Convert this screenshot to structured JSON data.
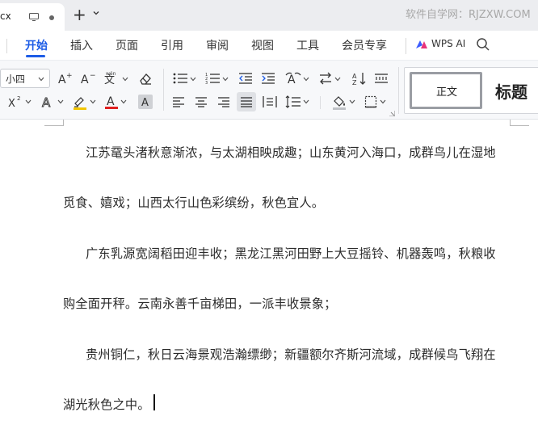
{
  "titlebar": {
    "doc_tab_name": "cx",
    "new_tab_symbol": "+",
    "watermark": "软件自学网：RJZXW.COM"
  },
  "menu": {
    "items": [
      "开始",
      "插入",
      "页面",
      "引用",
      "审阅",
      "视图",
      "工具",
      "会员专享"
    ],
    "active": "开始",
    "wps_ai": "WPS AI"
  },
  "toolbar": {
    "font_size": "小四",
    "styles": {
      "normal": "正文",
      "heading": "标题"
    }
  },
  "document": {
    "lines": [
      "江苏鼋头渚秋意渐浓，与太湖相映成趣；山东黄河入海口，成群鸟儿在湿地",
      "觅食、嬉戏；山西太行山色彩缤纷，秋色宜人。",
      "广东乳源宽阔稻田迎丰收；黑龙江黑河田野上大豆摇铃、机器轰鸣，秋粮收",
      "购全面开秤。云南永善千亩梯田，一派丰收景象；",
      "贵州铜仁，秋日云海景观浩瀚缥缈；新疆额尔齐斯河流域，成群候鸟飞翔在",
      "湖光秋色之中。"
    ]
  },
  "colors": {
    "accent": "#1d5ce6",
    "text_color_bar": "#e02020",
    "highlight_bar": "#f2c500"
  }
}
